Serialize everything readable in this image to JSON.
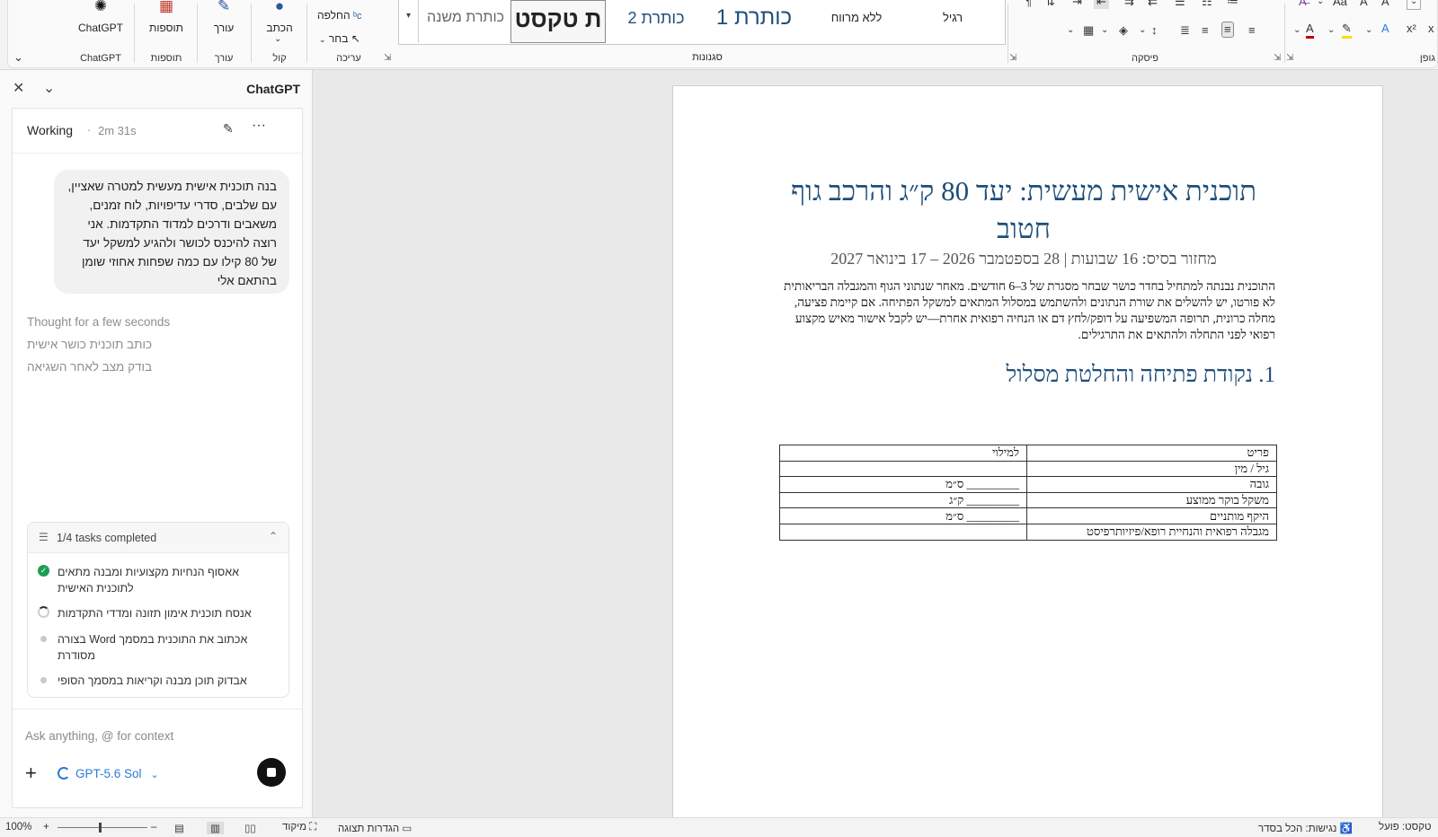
{
  "ribbon": {
    "chatgpt_btn": "ChatGPT",
    "chatgpt_group": "ChatGPT",
    "addins_btn": "תוספות",
    "addins_group": "תוספות",
    "editor_btn": "עורך",
    "editor_group": "עורך",
    "dictate_btn": "הכתב",
    "voice_group": "קול",
    "replace_btn": "החלפה",
    "select_btn": "בחר",
    "editing_group": "עריכה",
    "styles_group": "סגנונות",
    "paragraph_group": "פיסקה",
    "font_group": "גופן",
    "styles": [
      "כותרת משנה",
      "ת טקסט",
      "כותרת 2",
      "כותרת 1",
      "ללא מרווח",
      "רגיל"
    ]
  },
  "sidebar": {
    "title": "ChatGPT",
    "status_word": "Working",
    "status_sep": "·",
    "status_time": "2m 31s",
    "user_message": "בנה תוכנית אישית מעשית למטרה שאציין, עם שלבים, סדרי עדיפויות, לוח זמנים, משאבים ודרכים למדוד התקדמות. אני רוצה להיכנס לכושר ולהגיע למשקל יעד של 80 קילו עם כמה שפחות אחוזי שומן בהתאם אלי",
    "thought": "Thought for a few seconds",
    "step1": "כותב תוכנית כושר אישית",
    "step2": "בודק מצב לאחר השגיאה",
    "tasks_summary": "1/4 tasks completed",
    "tasks": [
      {
        "text": "אאסוף הנחיות מקצועיות ומבנה מתאים לתוכנית האישית",
        "state": "done"
      },
      {
        "text": "אנסח תוכנית אימון תזונה ומדדי התקדמות",
        "state": "in-progress"
      },
      {
        "text": "אכתוב את התוכנית במסמך Word בצורה מסודרת",
        "state": "todo"
      },
      {
        "text": "אבדוק תוכן מבנה וקריאות במסמך הסופי",
        "state": "todo"
      }
    ],
    "composer_placeholder": "Ask anything, @ for context",
    "model": "GPT-5.6 Sol"
  },
  "document": {
    "title": "תוכנית אישית מעשית: יעד 80 ק״ג והרכב גוף חטוב",
    "subtitle": "מחזור בסיס: 16 שבועות | 28 בספטמבר 2026 – 17 בינואר 2027",
    "intro": "התוכנית נבנתה למתחיל בחדר כושר שבחר מסגרת של 3–6 חודשים. מאחר שנתוני הגוף והמגבלה הבריאותית לא פורטו, יש להשלים את שורת הנתונים ולהשתמש במסלול המתאים למשקל הפתיחה. אם קיימת פציעה, מחלה כרונית, תרופה המשפיעה על דופק/לחץ דם או הנחיה רפואית אחרת—יש לקבל אישור מאיש מקצוע רפואי לפני התחלה ולהתאים את התרגילים.",
    "section1": "1. נקודת פתיחה והחלטת מסלול",
    "table_header": [
      "פריט",
      "למילוי"
    ],
    "table_rows": [
      [
        "גיל / מין",
        ""
      ],
      [
        "גובה",
        "_________ ס״מ"
      ],
      [
        "משקל בוקר ממוצע",
        "_________ ק״ג"
      ],
      [
        "היקף מותניים",
        "_________ ס״מ"
      ],
      [
        "מגבלה רפואית והנחיית רופא/פיזיותרפיסט",
        ""
      ]
    ]
  },
  "statusbar": {
    "zoom": "100%",
    "focus": "מיקוד",
    "display_settings": "הגדרות תצוגה",
    "accessibility": "נגישות: הכל בסדר",
    "text_predictions": "טקסט: פועל"
  }
}
